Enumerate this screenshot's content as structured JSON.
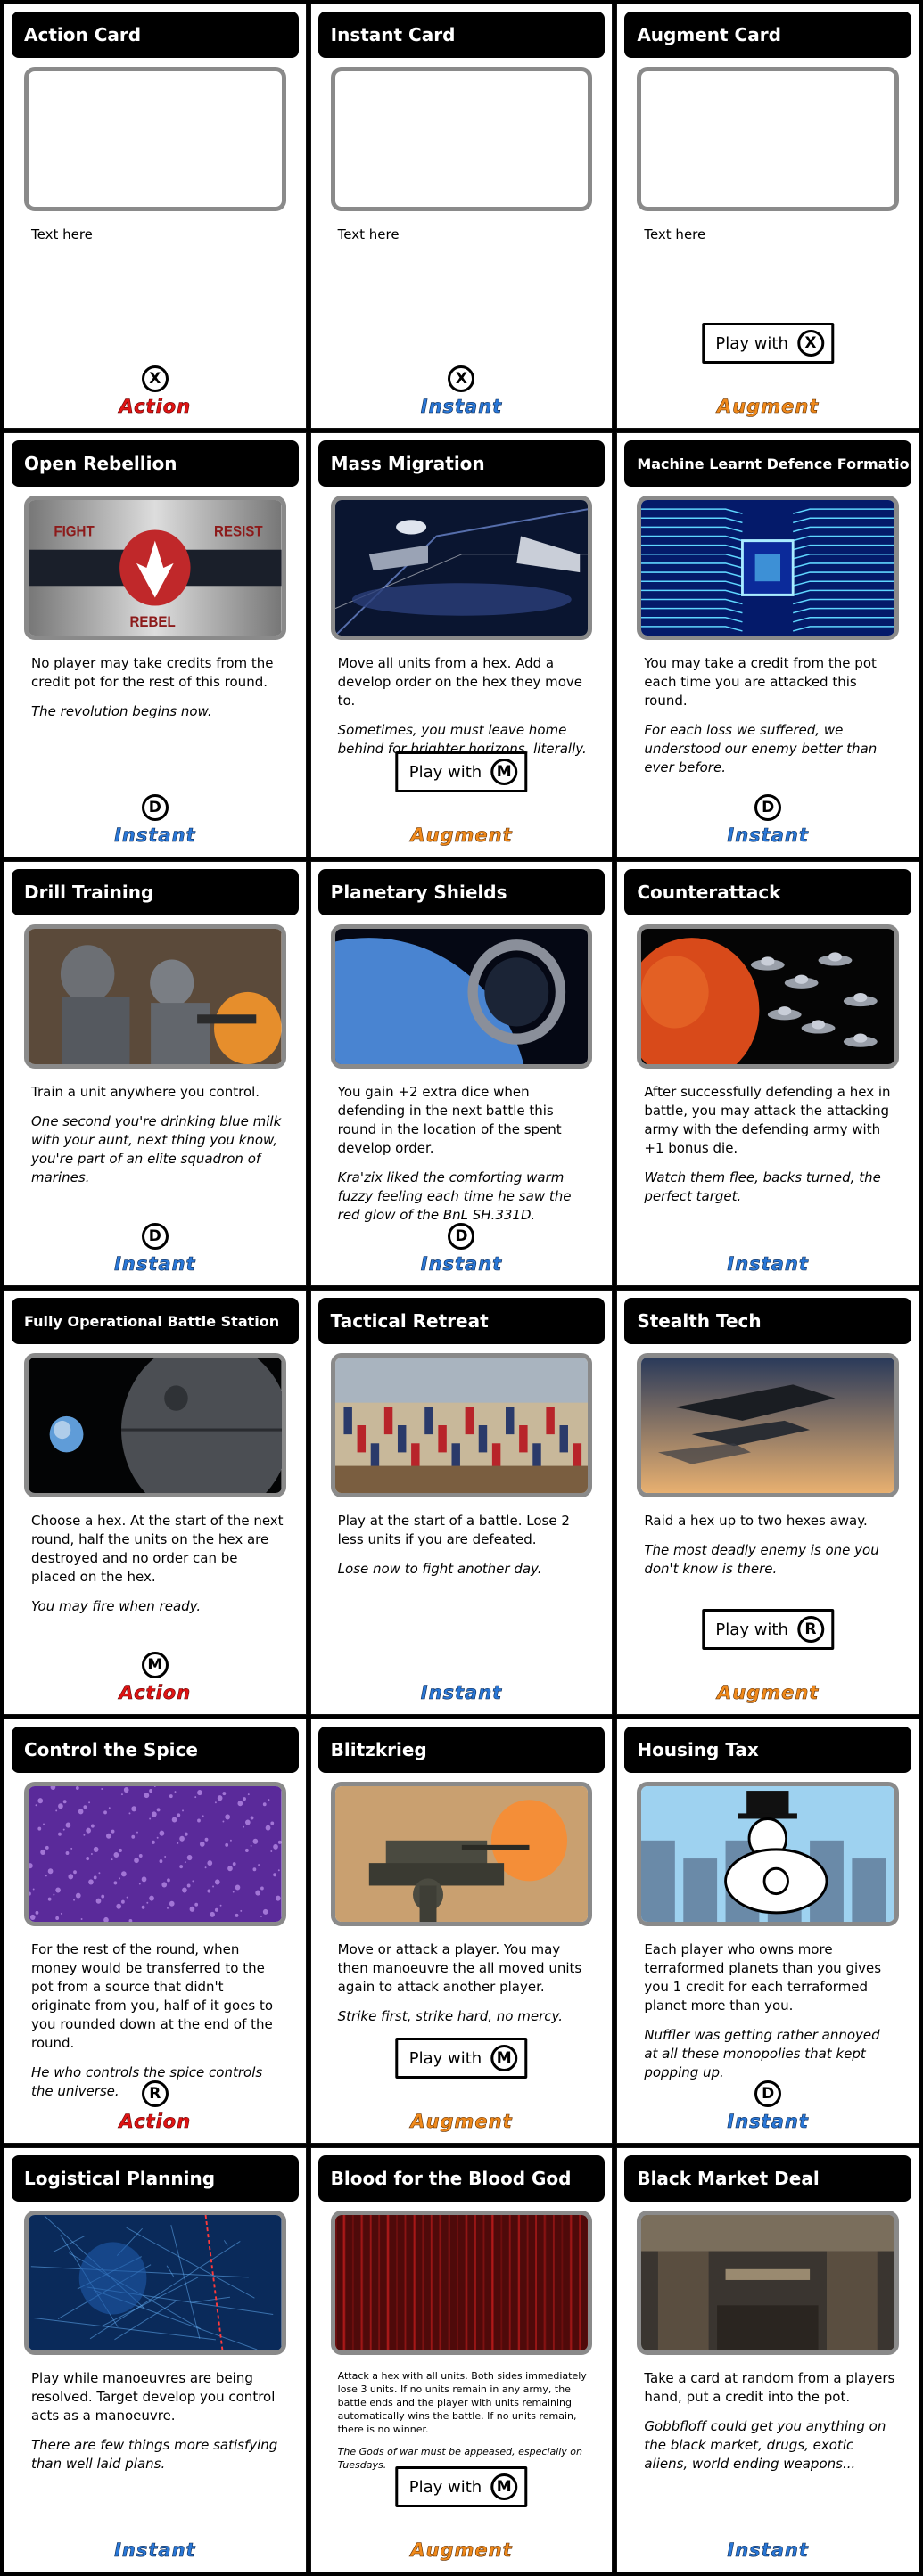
{
  "colors": {
    "action": "#e01414",
    "instant": "#2a78d8",
    "augment": "#f08a1c"
  },
  "cards": [
    {
      "title": "Action Card",
      "art": "blank",
      "body": [
        "Text here"
      ],
      "flavor": [],
      "marker": "X",
      "play_with": "",
      "type": "Action"
    },
    {
      "title": "Instant Card",
      "art": "blank",
      "body": [
        "Text here"
      ],
      "flavor": [],
      "marker": "X",
      "play_with": "",
      "type": "Instant"
    },
    {
      "title": "Augment Card",
      "art": "blank",
      "body": [
        "Text here"
      ],
      "flavor": [],
      "marker": "X",
      "play_with": "Play with",
      "type": "Augment"
    },
    {
      "title": "Open Rebellion",
      "art": "rebellion",
      "body": [
        "No player may take credits from the credit pot for the rest of this round."
      ],
      "flavor": [
        "The revolution begins now."
      ],
      "marker": "D",
      "play_with": "",
      "type": "Instant",
      "art_text": [
        "FIGHT",
        "RESIST",
        "REBEL"
      ]
    },
    {
      "title": "Mass Migration",
      "art": "space-fleet",
      "body": [
        "Move all units from a hex. Add a develop order on the hex they move to."
      ],
      "flavor": [
        "Sometimes, you must leave home behind for brighter horizons, literally."
      ],
      "marker": "M",
      "play_with": "Play with",
      "type": "Augment"
    },
    {
      "title": "Machine Learnt Defence Formations",
      "art": "circuit",
      "body": [
        "You may take a credit from the pot each time you are attacked this round."
      ],
      "flavor": [
        "For each loss we suffered, we understood our enemy better than ever before."
      ],
      "marker": "D",
      "play_with": "",
      "type": "Instant"
    },
    {
      "title": "Drill Training",
      "art": "soldiers",
      "body": [
        "Train a unit anywhere you control."
      ],
      "flavor": [
        "One second you're drinking blue milk with your aunt, next thing you know, you're part of an elite squadron of marines."
      ],
      "marker": "D",
      "play_with": "",
      "type": "Instant"
    },
    {
      "title": "Planetary Shields",
      "art": "planet-ring",
      "body": [
        "You gain +2 extra dice when defending in the next battle this round in the location of the spent develop order."
      ],
      "flavor": [
        "Kra'zix liked the comforting warm fuzzy feeling each time he saw the red glow of the BnL SH.331D."
      ],
      "marker": "D",
      "play_with": "",
      "type": "Instant"
    },
    {
      "title": "Counterattack",
      "art": "red-planet",
      "body": [
        "After successfully defending a hex in battle, you may attack the attacking army with the defending army with +1 bonus die."
      ],
      "flavor": [
        "Watch them flee, backs turned, the perfect target."
      ],
      "marker": "",
      "play_with": "",
      "type": "Instant"
    },
    {
      "title": "Fully Operational Battle Station",
      "art": "death-star",
      "body": [
        "Choose a hex. At the start of the next round, half the units on the hex are destroyed and no order can be placed on the hex."
      ],
      "flavor": [
        "You may fire when ready."
      ],
      "marker": "M",
      "play_with": "",
      "type": "Action"
    },
    {
      "title": "Tactical Retreat",
      "art": "battle",
      "body": [
        "Play at the start of a battle. Lose 2 less units if you are defeated."
      ],
      "flavor": [
        "Lose now to fight another day."
      ],
      "marker": "",
      "play_with": "",
      "type": "Instant"
    },
    {
      "title": "Stealth Tech",
      "art": "stealth",
      "body": [
        "Raid a hex up to two hexes away."
      ],
      "flavor": [
        "The most deadly enemy is one you don't know is there."
      ],
      "marker": "R",
      "play_with": "Play with",
      "type": "Augment"
    },
    {
      "title": "Control the Spice",
      "art": "spice",
      "body": [
        "For the rest of the round, when money would be transferred to the pot from a source that didn't originate from you, half of it goes to you rounded down at the end of the round."
      ],
      "flavor": [
        "He who controls the spice controls the universe."
      ],
      "marker": "R",
      "play_with": "",
      "type": "Action"
    },
    {
      "title": "Blitzkrieg",
      "art": "tank",
      "body": [
        "Move or attack a player. You may then manoeuvre the all moved units again to attack another player."
      ],
      "flavor": [
        "Strike first, strike hard, no mercy."
      ],
      "marker": "M",
      "play_with": "Play with",
      "type": "Augment"
    },
    {
      "title": "Housing Tax",
      "art": "monopoly",
      "body": [
        "Each player who owns more terraformed planets than you gives you 1 credit for each terraformed planet more than you."
      ],
      "flavor": [
        "Nuffler was getting rather annoyed at all these monopolies that kept popping up."
      ],
      "marker": "D",
      "play_with": "",
      "type": "Instant"
    },
    {
      "title": "Logistical Planning",
      "art": "map",
      "body": [
        "Play while manoeuvres are being resolved. Target develop you control acts as a manoeuvre."
      ],
      "flavor": [
        "There are few things more satisfying than well laid plans."
      ],
      "marker": "",
      "play_with": "",
      "type": "Instant"
    },
    {
      "title": "Blood for the Blood God",
      "art": "blood",
      "body": [
        "Attack a hex with all units. Both sides immediately lose 3 units. If no units remain in any army, the battle ends and the player with units remaining automatically wins the battle. If no units remain, there is no winner."
      ],
      "flavor": [
        "The Gods of war must be appeased, especially on Tuesdays."
      ],
      "marker": "M",
      "play_with": "Play with",
      "type": "Augment",
      "tiny": true
    },
    {
      "title": "Black Market Deal",
      "art": "market",
      "body": [
        "Take a card at random from a players hand, put a credit into the pot."
      ],
      "flavor": [
        "Gobbfloff could get you anything on the black market, drugs, exotic aliens, world ending weapons..."
      ],
      "marker": "",
      "play_with": "",
      "type": "Instant"
    }
  ]
}
